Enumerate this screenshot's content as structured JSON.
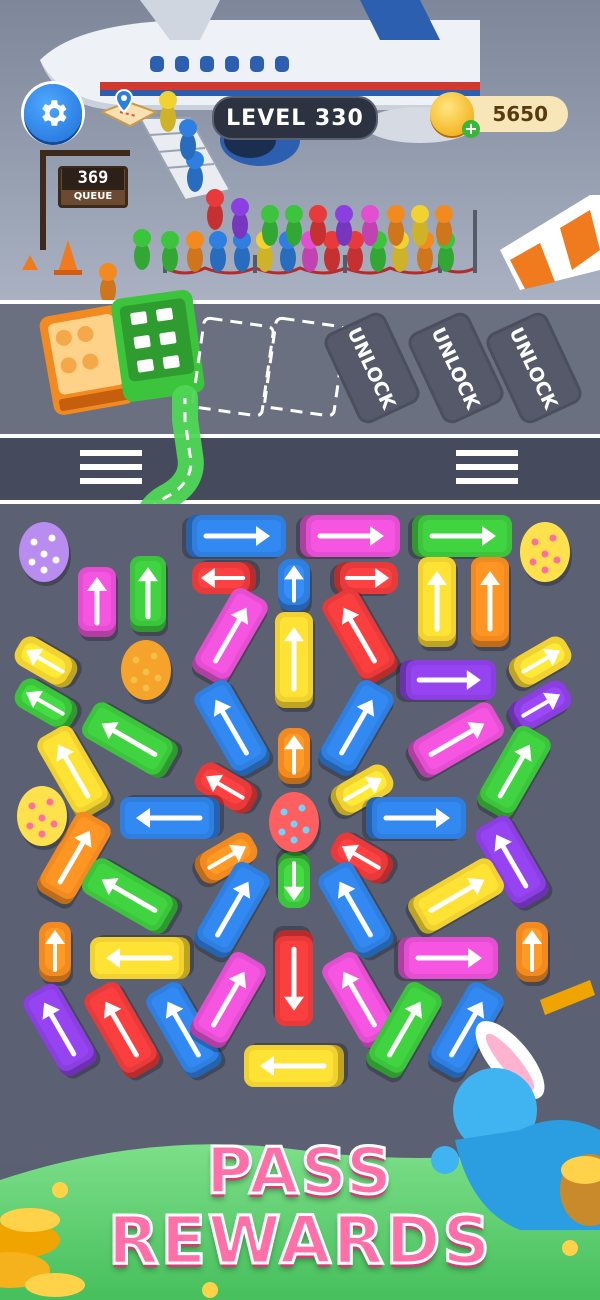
{
  "hud": {
    "level_label": "LEVEL 330",
    "coins": "5650",
    "queue_number": "369",
    "queue_label": "QUEUE"
  },
  "parking": {
    "locked_slot_label": "UNLOCK",
    "locked_slots": 3
  },
  "banner": {
    "line1": "PASS",
    "line2": "REWARDS"
  },
  "icons": [
    "gear-icon",
    "map-pin-icon",
    "coin-icon",
    "plus-icon",
    "arrow-icon",
    "easter-egg-icon"
  ],
  "colors": {
    "road": "#5a6072",
    "lane_line": "#ffffff",
    "accent_blue": "#1f6fd6",
    "banner_pink": "#ff6fa8",
    "vehicle_colors": [
      "#e83a3a",
      "#2f7fe0",
      "#f2d230",
      "#3cc43c",
      "#e34fd0",
      "#8b3fe0",
      "#f38a20",
      "#35c0e0"
    ]
  }
}
